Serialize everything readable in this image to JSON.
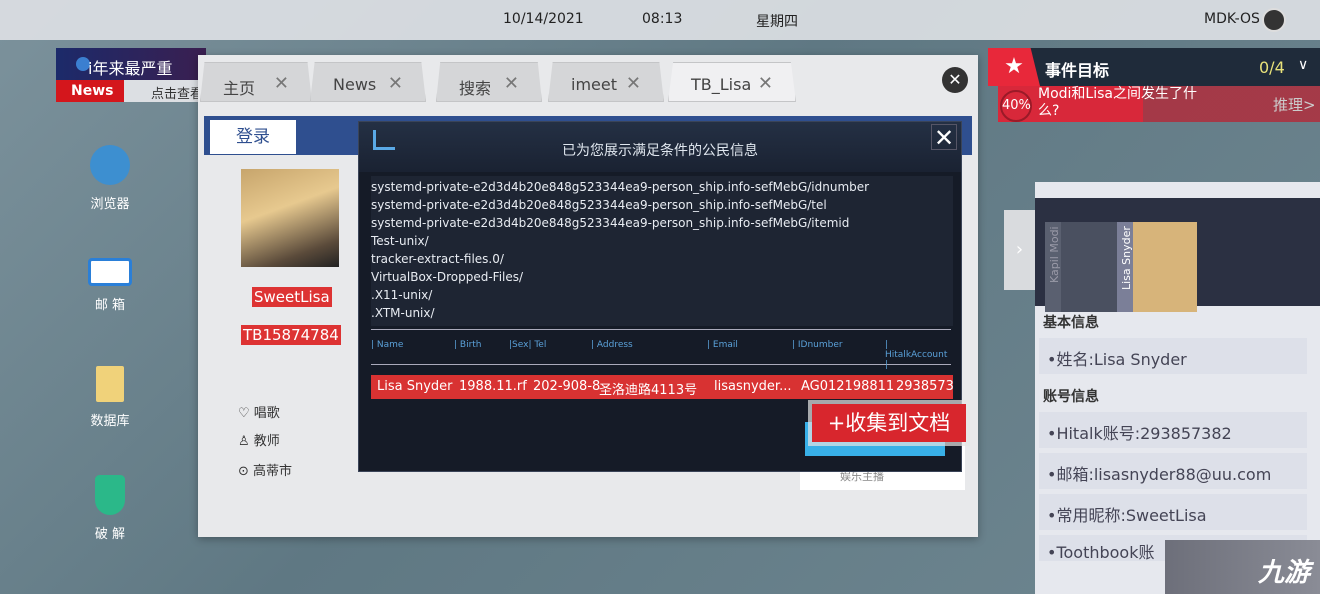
{
  "topbar": {
    "date": "10/14/2021",
    "time": "08:13",
    "weekday": "星期四",
    "os": "MDK-OS"
  },
  "news": {
    "headline": "i年来最严重",
    "label": "News",
    "sub": "点击查看"
  },
  "desktop": [
    {
      "label": "浏览器",
      "icon": "globe-icon"
    },
    {
      "label": "邮 箱",
      "icon": "mail-icon"
    },
    {
      "label": "数据库",
      "icon": "sql-file-icon"
    },
    {
      "label": "破 解",
      "icon": "shield-key-icon"
    }
  ],
  "browser": {
    "tabs": [
      {
        "label": "主页"
      },
      {
        "label": "News"
      },
      {
        "label": "搜索"
      },
      {
        "label": "imeet"
      },
      {
        "label": "TB_Lisa"
      }
    ],
    "login": "登录",
    "profile": {
      "name": "SweetLisa",
      "id": "TB15874784",
      "hobby": "唱歌",
      "job": "教师",
      "city": "高蒂市"
    },
    "side_sub": "娱乐主播"
  },
  "dialog": {
    "title": "已为您展示满足条件的公民信息",
    "lines": [
      "systemd-private-e2d3d4b20e848g523344ea9-person_ship.info-sefMebG/idnumber",
      "systemd-private-e2d3d4b20e848g523344ea9-person_ship.info-sefMebG/tel",
      "systemd-private-e2d3d4b20e848g523344ea9-person_ship.info-sefMebG/itemid",
      "Test-unix/",
      "tracker-extract-files.0/",
      "VirtualBox-Dropped-Files/",
      ".X11-unix/",
      ".XTM-unix/"
    ],
    "columns": [
      "| Name",
      "| Birth",
      "|Sex| Tel",
      "| Address",
      "| Email",
      "| IDnumber",
      "| HitalkAccount |"
    ],
    "row": [
      "Lisa Snyder",
      "1988.11.rf",
      "202-908-8",
      "圣洛迪路4113号",
      "lisasnyder...",
      "AG012198811",
      "2938573"
    ],
    "collect": "+收集到文档"
  },
  "objective": {
    "title": "事件目标",
    "count": "0/4",
    "progress": "40%",
    "question": "Modi和Lisa之间发生了什么?",
    "reason": "推理>",
    "accent": "#e8283a"
  },
  "panel": {
    "cards": [
      "Kapil Modi",
      "Lisa Snyder"
    ],
    "basic": "基本信息",
    "name": "•姓名:Lisa Snyder",
    "account": "账号信息",
    "items": [
      "•Hitalk账号:293857382",
      "•邮箱:lisasnyder88@uu.com",
      "•常用昵称:SweetLisa",
      "•Toothbook账"
    ]
  },
  "watermark": "九游"
}
